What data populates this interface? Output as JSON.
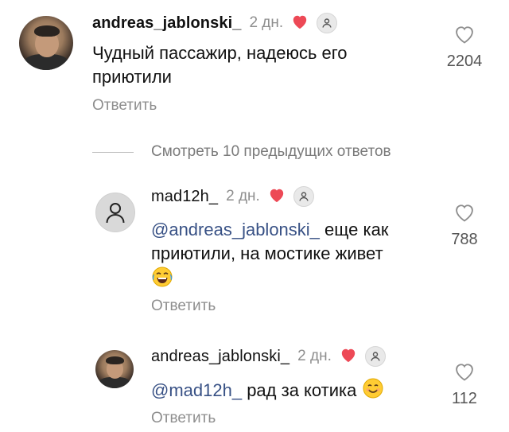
{
  "comments": [
    {
      "username": "andreas_jablonski_",
      "time": "2 дн.",
      "text": "Чудный пассажир, надеюсь его приютили",
      "text_line1": "Чудный пассажир, надеюсь его",
      "text_line2": "приютили",
      "reply_label": "Ответить",
      "likes": "2204"
    }
  ],
  "view_previous": "Смотреть 10 предыдущих ответов",
  "replies": [
    {
      "username": "mad12h_",
      "time": "2 дн.",
      "mention": "@andreas_jablonski_",
      "text_line1_rest": " еще как",
      "text_line2": "приютили, на мостике живет",
      "emoji": "tears-of-joy-emoji",
      "reply_label": "Ответить",
      "likes": "788"
    },
    {
      "username": "andreas_jablonski_",
      "time": "2 дн.",
      "mention": "@mad12h_",
      "text_rest": " рад за котика ",
      "emoji": "smiling-face-emoji",
      "reply_label": "Ответить",
      "likes": "112"
    }
  ],
  "colors": {
    "heart": "#ed4956",
    "mention": "#385185",
    "secondary": "#8e8e8e"
  },
  "icons": [
    "heart-icon",
    "user-badge-icon",
    "like-outline-icon",
    "default-avatar-icon"
  ]
}
